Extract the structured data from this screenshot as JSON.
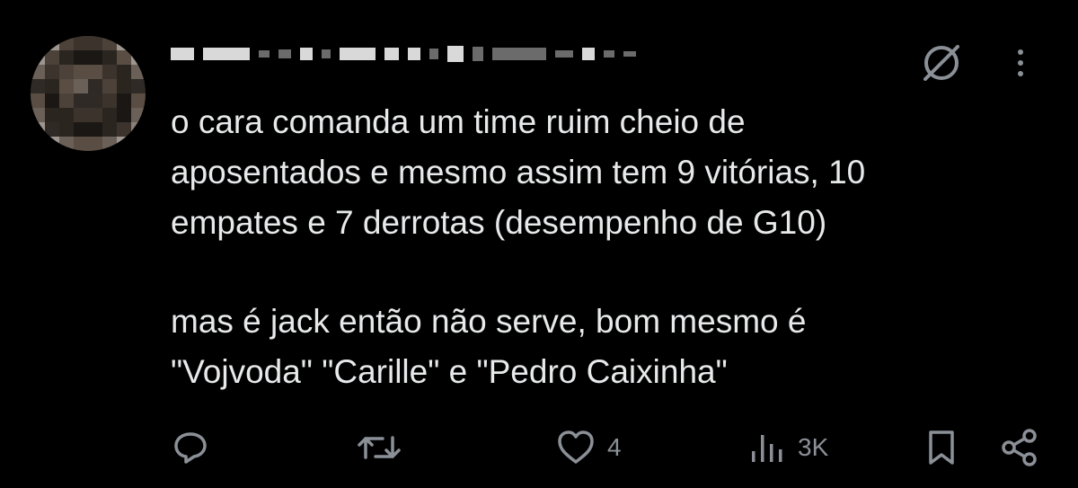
{
  "post": {
    "paragraphs": [
      "o cara comanda um time ruim cheio de",
      "aposentados e mesmo assim tem 9 vitórias, 10",
      "empates e 7 derrotas (desempenho de G10)",
      "mas é jack então não serve, bom mesmo é",
      "\"Vojvoda\" \"Carille\" e \"Pedro Caixinha\""
    ]
  },
  "actions": {
    "reply_count": "",
    "repost_count": "",
    "like_count": "4",
    "views_count": "3K"
  },
  "icons": {
    "grok": "grok-icon",
    "more": "more-vertical-icon",
    "reply": "reply-icon",
    "repost": "repost-icon",
    "like": "heart-icon",
    "views": "views-icon",
    "bookmark": "bookmark-icon",
    "share": "share-icon"
  },
  "colors": {
    "background": "#000000",
    "text": "#e7e9ea",
    "muted": "#8b9097"
  }
}
